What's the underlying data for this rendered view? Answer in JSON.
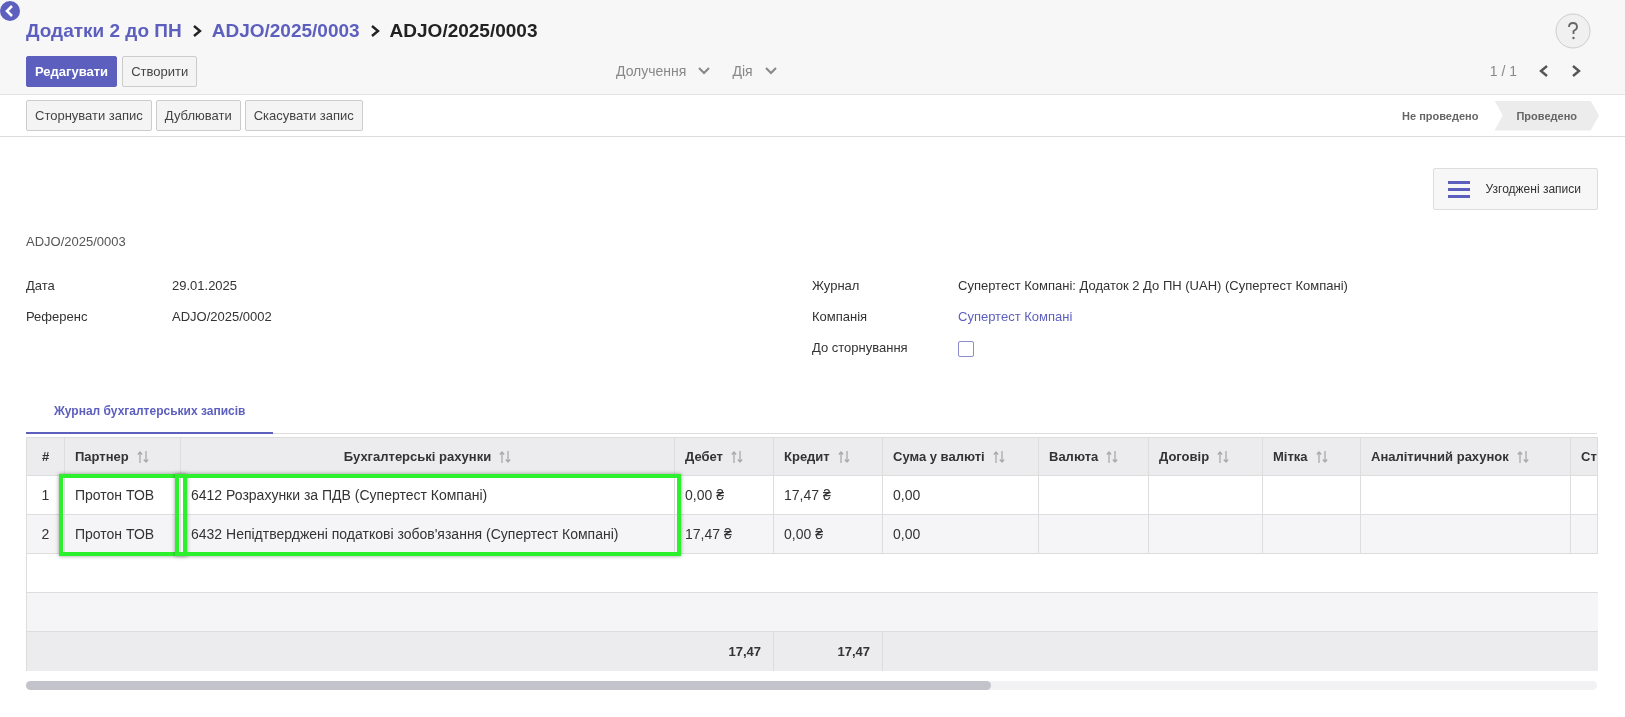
{
  "breadcrumbs": [
    {
      "label": "Додатки 2 до ПН",
      "link": true
    },
    {
      "label": "ADJO/2025/0003",
      "link": true
    },
    {
      "label": "ADJO/2025/0003",
      "link": false
    }
  ],
  "buttons": [
    {
      "label": "Редагувати",
      "primary": true
    },
    {
      "label": "Створити",
      "primary": false
    }
  ],
  "menus": [
    "Долучення",
    "Дія"
  ],
  "pager": "1 / 1",
  "action_buttons": [
    "Сторнувати запис",
    "Дублювати",
    "Скасувати запис"
  ],
  "status_steps": [
    {
      "label": "Не проведено",
      "selected": false
    },
    {
      "label": "Проведено",
      "selected": true
    }
  ],
  "smart_button": "Узгоджені записи",
  "record_name": "ADJO/2025/0003",
  "fields_left": [
    {
      "label": "Дата",
      "kind": "text",
      "value": "29.01.2025"
    },
    {
      "label": "Референс",
      "kind": "text",
      "value": "ADJO/2025/0002"
    }
  ],
  "fields_right": [
    {
      "label": "Журнал",
      "kind": "text",
      "value": "Супертест Компані: Додаток 2 До ПН (UAH) (Супертест Компані)"
    },
    {
      "label": "Компанія",
      "kind": "link",
      "value": "Супертест Компані"
    },
    {
      "label": "До сторнування",
      "kind": "checkbox",
      "checked": false
    }
  ],
  "tabs": [
    {
      "label": "Журнал бухгалтерських записів",
      "selected": true
    }
  ],
  "table": {
    "columns": [
      {
        "label": "#",
        "sortable": false,
        "highlighted": false
      },
      {
        "label": "Партнер",
        "sortable": true,
        "highlighted": true
      },
      {
        "label": "Бухгалтерські рахунки",
        "sortable": true,
        "highlighted": true
      },
      {
        "label": "Дебет",
        "sortable": true,
        "highlighted": false,
        "total": "17,47"
      },
      {
        "label": "Кредит",
        "sortable": true,
        "highlighted": false,
        "total": "17,47"
      },
      {
        "label": "Сума у валюті",
        "sortable": true,
        "highlighted": false
      },
      {
        "label": "Валюта",
        "sortable": true,
        "highlighted": false
      },
      {
        "label": "Договір",
        "sortable": true,
        "highlighted": false
      },
      {
        "label": "Мітка",
        "sortable": true,
        "highlighted": false
      },
      {
        "label": "Аналітичний рахунок",
        "sortable": true,
        "highlighted": false
      },
      {
        "label": "Ст",
        "highlighted": false
      }
    ],
    "rows": [
      {
        "cells": [
          "1",
          "Протон ТОВ",
          "6412 Розрахунки за ПДВ (Супертест Компані)",
          "0,00 ₴",
          "17,47 ₴",
          "0,00"
        ]
      },
      {
        "cells": [
          "2",
          "Протон ТОВ",
          "6432 Непідтверджені податкові зобов'язання (Супертест Компані)",
          "17,47 ₴",
          "0,00 ₴",
          "0,00"
        ]
      }
    ]
  }
}
